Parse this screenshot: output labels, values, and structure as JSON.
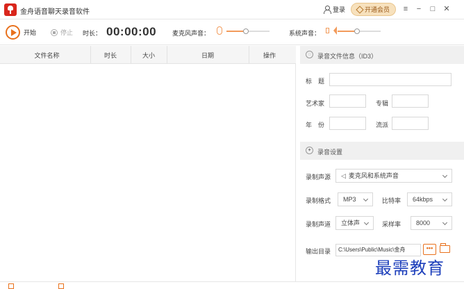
{
  "app": {
    "title": "金舟语音聊天录音软件",
    "login_label": "登录",
    "vip_label": "开通会员",
    "window_controls": [
      "≡",
      "−",
      "□",
      "✕"
    ]
  },
  "toolbar": {
    "start_label": "开始",
    "stop_label": "停止",
    "duration_label": "时长：",
    "timer": "00:00:00",
    "mic_label": "麦克风声音：",
    "system_label": "系统声音：",
    "mic_volume": 0.45,
    "system_volume": 0.45
  },
  "table": {
    "columns": [
      "文件名称",
      "时长",
      "大小",
      "日期",
      "操作"
    ]
  },
  "id3": {
    "section_title": "录音文件信息（ID3）",
    "title_label": "标　题",
    "artist_label": "艺术家",
    "album_label": "专辑",
    "year_label": "年　份",
    "genre_label": "流派"
  },
  "recording": {
    "section_title": "录音设置",
    "source_label": "录制声源",
    "source_value": "麦克风和系统声音",
    "format_label": "录制格式",
    "format_value": "MP3",
    "bitrate_label": "比特率",
    "bitrate_value": "64kbps",
    "channel_label": "录制声道",
    "channel_value": "立体声",
    "sample_rate_label": "采样率",
    "sample_rate_value": "8000",
    "output_label": "输出目录",
    "output_path": "C:\\Users\\Public\\Music\\金舟",
    "more_button": "•••"
  },
  "overlay": {
    "watermark": "最需教育"
  }
}
